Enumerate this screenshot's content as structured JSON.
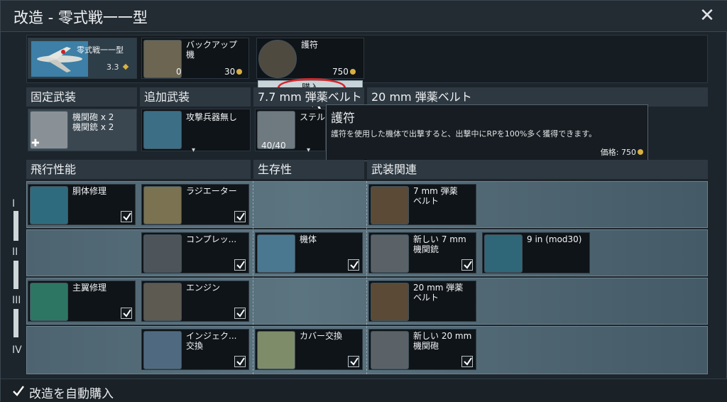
{
  "window": {
    "title": "改造 - 零式戦一一型",
    "close_label": "✕"
  },
  "top": {
    "plane": {
      "name": "零式戦一一型",
      "br": "3.3"
    },
    "backup": {
      "label": "バックアップ\n機",
      "count": "0",
      "price": "30"
    },
    "talisman": {
      "label": "護符",
      "price": "750",
      "buy_label": "購入"
    }
  },
  "weapons": {
    "headers": [
      "固定武装",
      "追加武装",
      "7.7 mm 弾薬ベルト",
      "20 mm 弾薬ベルト"
    ],
    "fixed": "機関砲 x 2\n機関銃 x 2",
    "secondary": "攻撃兵器無し",
    "belt_label": "ステル",
    "belt_count": "40",
    "belt_total": "40"
  },
  "tooltip": {
    "title": "護符",
    "body": "護符を使用した機体で出撃すると、出撃中にRPを100%多く獲得できます。",
    "price_label": "価格: 750"
  },
  "sections": [
    "飛行性能",
    "生存性",
    "武装関連"
  ],
  "tiers": [
    "I",
    "II",
    "III",
    "IV"
  ],
  "mods": {
    "fuselage": "胴体修理",
    "radiator": "ラジエーター",
    "belt7": "7 mm 弾薬\nベルト",
    "compressor": "コンプレッ...",
    "airframe": "機体",
    "new7": "新しい 7 mm\n機関銃",
    "rocket": "9 in (mod30)",
    "wing": "主翼修理",
    "engine": "エンジン",
    "belt20": "20 mm 弾薬\nベルト",
    "injection": "インジェク...\n交換",
    "cover": "カバー交換",
    "new20": "新しい 20 mm\n機関砲"
  },
  "footer": {
    "auto_buy": "改造を自動購入"
  },
  "colors": {
    "accent": "#d9b040",
    "buy_highlight": "#d8262b"
  }
}
